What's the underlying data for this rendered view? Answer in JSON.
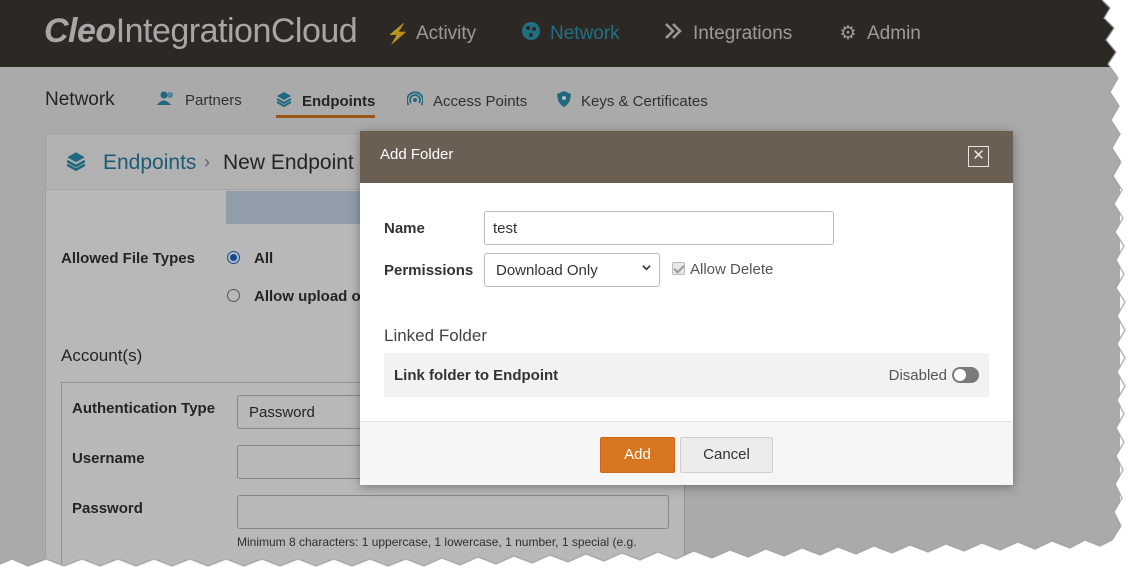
{
  "brand": {
    "part1": "Cleo",
    "part2": "IntegrationCloud"
  },
  "topnav": [
    {
      "label": "Activity",
      "icon": "activity-icon"
    },
    {
      "label": "Network",
      "icon": "network-icon",
      "active": true
    },
    {
      "label": "Integrations",
      "icon": "integrations-icon"
    },
    {
      "label": "Admin",
      "icon": "gear-icon"
    }
  ],
  "subnav": {
    "title": "Network",
    "items": [
      {
        "label": "Partners",
        "icon": "partners-icon"
      },
      {
        "label": "Endpoints",
        "icon": "layers-icon",
        "active": true
      },
      {
        "label": "Access Points",
        "icon": "access-point-icon"
      },
      {
        "label": "Keys & Certificates",
        "icon": "shield-icon"
      }
    ]
  },
  "breadcrumb": {
    "parent": "Endpoints",
    "separator": "›",
    "current": "New Endpoint"
  },
  "form": {
    "allowed_file_types_label": "Allowed File Types",
    "option_all": "All",
    "option_upload": "Allow upload of",
    "accounts_title": "Account(s)",
    "auth_type_label": "Authentication Type",
    "auth_type_value": "Password",
    "username_label": "Username",
    "password_label": "Password",
    "password_hint": "Minimum 8 characters: 1 uppercase, 1 lowercase, 1 number, 1 special (e.g."
  },
  "modal": {
    "title": "Add Folder",
    "close_symbol": "✕",
    "name_label": "Name",
    "name_value": "test",
    "permissions_label": "Permissions",
    "permissions_value": "Download Only",
    "allow_delete_label": "Allow Delete",
    "allow_delete_checked": true,
    "linked_folder_title": "Linked Folder",
    "link_row_label": "Link folder to Endpoint",
    "link_state_label": "Disabled",
    "add_button": "Add",
    "cancel_button": "Cancel"
  },
  "colors": {
    "topbar": "#3e3a33",
    "accent_blue": "#2d9bb8",
    "accent_orange": "#d8761f",
    "modal_header": "#6b5e52"
  }
}
